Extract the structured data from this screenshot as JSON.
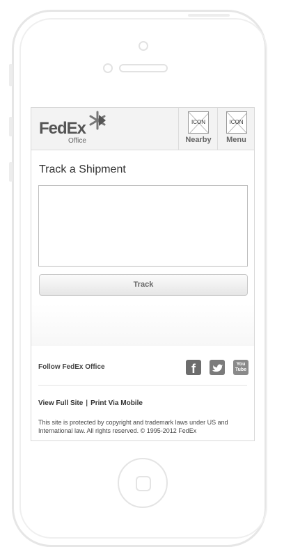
{
  "header": {
    "logo": {
      "brand": "FedEx",
      "sub": "Office"
    },
    "nearby": {
      "icon_text": "ICON",
      "label": "Nearby"
    },
    "menu": {
      "icon_text": "ICON",
      "label": "Menu"
    }
  },
  "main": {
    "title": "Track a Shipment",
    "input_value": "",
    "track_button": "Track"
  },
  "footer": {
    "follow_label": "Follow FedEx Office",
    "social": [
      "facebook-icon",
      "twitter-icon",
      "youtube-icon"
    ],
    "youtube_text_1": "You",
    "youtube_text_2": "Tube",
    "link_full_site": "View Full Site",
    "separator": "|",
    "link_print": "Print Via Mobile",
    "legal": "This site is protected by copyright and trademark laws under US and International law. All rights reserved. © 1995-2012 FedEx"
  },
  "colors": {
    "brand_gray": "#555555",
    "border": "#d8d8d8"
  }
}
